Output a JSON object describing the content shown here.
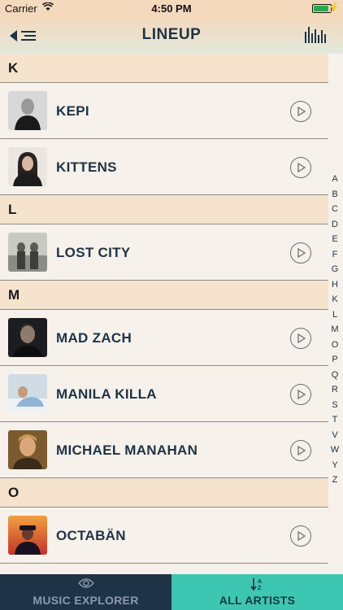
{
  "status_bar": {
    "carrier": "Carrier",
    "time": "4:50 PM",
    "battery_level": 0.9
  },
  "nav": {
    "title": "LINEUP",
    "back_icon": "back-arrow-icon",
    "menu_icon": "menu-icon",
    "eq_icon": "equalizer-icon"
  },
  "sections": [
    {
      "letter": "K",
      "artists": [
        {
          "name": "KEPI"
        },
        {
          "name": "KITTENS"
        }
      ]
    },
    {
      "letter": "L",
      "artists": [
        {
          "name": "LOST CITY"
        }
      ]
    },
    {
      "letter": "M",
      "artists": [
        {
          "name": "MAD ZACH"
        },
        {
          "name": "MANILA KILLA"
        },
        {
          "name": "MICHAEL MANAHAN"
        }
      ]
    },
    {
      "letter": "O",
      "artists": [
        {
          "name": "OCTABÄN"
        }
      ]
    }
  ],
  "index_letters": [
    "A",
    "B",
    "C",
    "D",
    "E",
    "F",
    "G",
    "H",
    "K",
    "L",
    "M",
    "O",
    "P",
    "Q",
    "R",
    "S",
    "T",
    "V",
    "W",
    "Y",
    "Z"
  ],
  "tabs": [
    {
      "label": "MUSIC EXPLORER",
      "icon": "eye-icon",
      "active": false
    },
    {
      "label": "ALL ARTISTS",
      "icon": "sort-az-icon",
      "active": true
    }
  ],
  "colors": {
    "navy": "#1f3347",
    "teal": "#3dc7b3",
    "header_bg": "#f6e3cd",
    "list_bg": "#f6f1ea"
  }
}
